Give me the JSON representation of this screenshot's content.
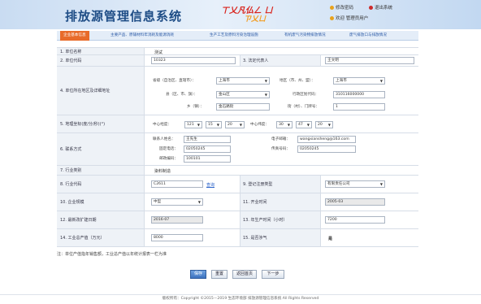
{
  "header": {
    "title": "排放源管理信息系统",
    "seal_line1": "ㄒ乂凡仏ㄥ ㄩ",
    "seal_line2": "ㄗ乂ㄩ",
    "links": [
      "修改密码",
      "退出系统",
      "欢迎 管理员用户"
    ]
  },
  "nav": {
    "tabs": [
      "企业基本信息",
      "主要产品、原辅材料年消耗及能源消耗",
      "生产工艺及原料污染治理设施",
      "有机废气污染物排放情况",
      "废气排放口与排放情况"
    ]
  },
  "form": {
    "row1": {
      "label": "1. 单位名称",
      "value": "测试"
    },
    "row2": {
      "label": "2. 单位代码",
      "value": "10323",
      "label2": "3. 法定代表人",
      "value2": "王文明"
    },
    "row4": {
      "label": "4. 单位所在地区及详细地址",
      "province_label": "省级（自治区、直辖市）：",
      "province": "上海市",
      "city_label": "地区（市、州、盟）：",
      "city": "上海市",
      "county_label": "县（区、市、旗）：",
      "county": "金山区",
      "code_label": "行政区划代码：",
      "code": "310116000000",
      "town_label": "乡（镇）：",
      "town": "金石路街",
      "street_label": "街（村）、门牌号：",
      "street": "1"
    },
    "row5": {
      "label": "5. 地理坐标(度/分/秒)(°)",
      "lng_label": "中心经度：",
      "lng": [
        "121",
        "15",
        "20"
      ],
      "lat_label": "中心纬度：",
      "lat": [
        "30",
        "47",
        "20"
      ]
    },
    "row6": {
      "label": "6. 联系方式",
      "contact_label": "联系人姓名：",
      "contact": "王先生",
      "email_label": "电子邮箱：",
      "email": "wangxiansheng@163.com",
      "phone_label": "固定电话：",
      "phone": "02050245",
      "fax_label": "传真号码：",
      "fax": "02050245",
      "zip_label": "邮政编码：",
      "zip": "100101"
    },
    "row7": {
      "label": "7. 行业类别",
      "value": "染料制造"
    },
    "row8": {
      "label": "8. 行业代码",
      "value": "C2611",
      "link": "查询",
      "label2": "9. 登记注册类型",
      "value2": "有限责任公司"
    },
    "row10": {
      "label": "10. 企业规模",
      "value": "中型",
      "label2": "11. 开业时间",
      "value2": "2005-03"
    },
    "row12": {
      "label": "12. 最新改扩建日期",
      "value": "2016-07",
      "label2": "13. 年生产时间（小时）",
      "value2": "7200"
    },
    "row14": {
      "label": "14. 工业总产值（万元）",
      "value": "8000",
      "label2": "15. 是否涉气",
      "value2": "是"
    }
  },
  "note": "注：单位产值指年销售额，工业总产值以年统计报表一栏为准",
  "buttons": [
    "保存",
    "重置",
    "返回首页",
    "下一步"
  ],
  "footer": "版权所有：Copyright ©2015－2019 生态环境部 排放源管理信息系统 All Rights Reserved"
}
